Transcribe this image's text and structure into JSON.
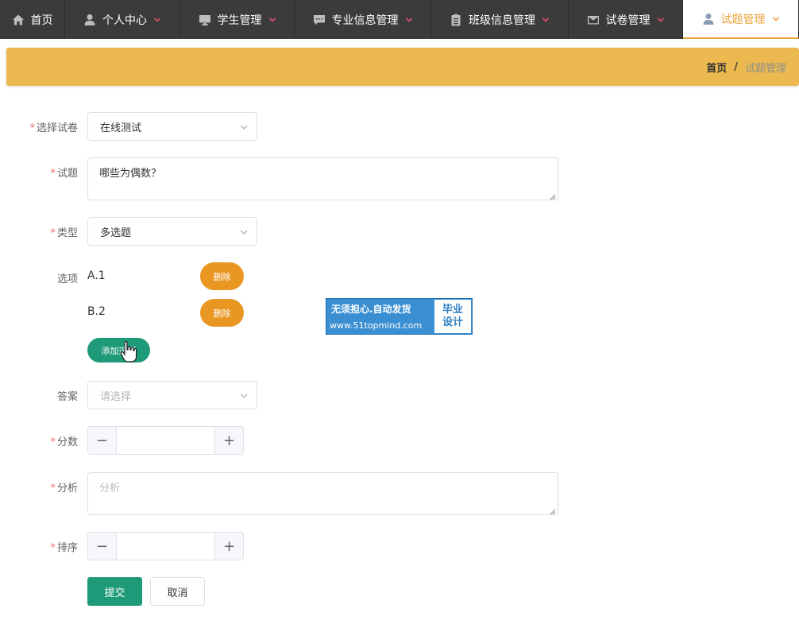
{
  "nav": {
    "items": [
      {
        "label": "首页",
        "icon": "home-icon"
      },
      {
        "label": "个人中心",
        "icon": "user-icon"
      },
      {
        "label": "学生管理",
        "icon": "monitor-icon"
      },
      {
        "label": "专业信息管理",
        "icon": "chat-icon"
      },
      {
        "label": "班级信息管理",
        "icon": "clipboard-icon"
      },
      {
        "label": "试卷管理",
        "icon": "mail-icon"
      },
      {
        "label": "试题管理",
        "icon": "user-icon"
      }
    ],
    "active_index": 6,
    "accent": "#e8a43a"
  },
  "breadcrumb": {
    "home": "首页",
    "separator": "/",
    "current": "试题管理"
  },
  "form": {
    "paper": {
      "label": "选择试卷",
      "value": "在线测试"
    },
    "question": {
      "label": "试题",
      "value": "哪些为偶数？"
    },
    "type": {
      "label": "类型",
      "value": "多选题"
    },
    "options": {
      "label": "选项",
      "items": [
        {
          "text": "A.1",
          "delete_label": "删除"
        },
        {
          "text": "B.2",
          "delete_label": "删除"
        }
      ],
      "add_label": "添加选项"
    },
    "answer": {
      "label": "答案",
      "placeholder": "请选择"
    },
    "score": {
      "label": "分数",
      "value": "",
      "minus": "−",
      "plus": "+"
    },
    "analysis": {
      "label": "分析",
      "placeholder": "分析"
    },
    "sort": {
      "label": "排序",
      "value": "",
      "minus": "−",
      "plus": "+"
    },
    "submit_label": "提交",
    "cancel_label": "取消",
    "required_mark": "*"
  },
  "watermark": {
    "line1": "无须担心.自动发货",
    "line2": "www.51topmind.com",
    "box_line1": "毕业",
    "box_line2": "设计"
  },
  "colors": {
    "banner": "#ebb94f",
    "primary": "#1f9a79",
    "danger": "#e99722",
    "nav_bg": "#3b3b3b"
  }
}
